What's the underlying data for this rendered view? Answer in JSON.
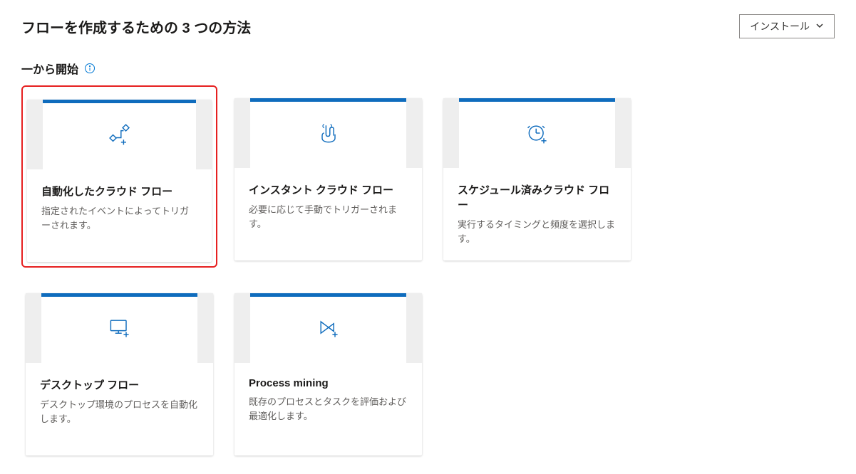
{
  "header": {
    "title": "フローを作成するための 3 つの方法",
    "install_label": "インストール"
  },
  "section": {
    "title": "一から開始"
  },
  "cards": [
    {
      "icon": "automated-flow-icon",
      "title": "自動化したクラウド フロー",
      "desc": "指定されたイベントによってトリガーされます。",
      "highlighted": true
    },
    {
      "icon": "instant-flow-icon",
      "title": "インスタント クラウド フロー",
      "desc": "必要に応じて手動でトリガーされます。",
      "highlighted": false
    },
    {
      "icon": "scheduled-flow-icon",
      "title": "スケジュール済みクラウド フロー",
      "desc": "実行するタイミングと頻度を選択します。",
      "highlighted": false
    },
    {
      "icon": "desktop-flow-icon",
      "title": "デスクトップ フロー",
      "desc": "デスクトップ環境のプロセスを自動化します。",
      "highlighted": false
    },
    {
      "icon": "process-mining-icon",
      "title": "Process mining",
      "desc": "既存のプロセスとタスクを評価および最適化します。",
      "highlighted": false
    }
  ]
}
